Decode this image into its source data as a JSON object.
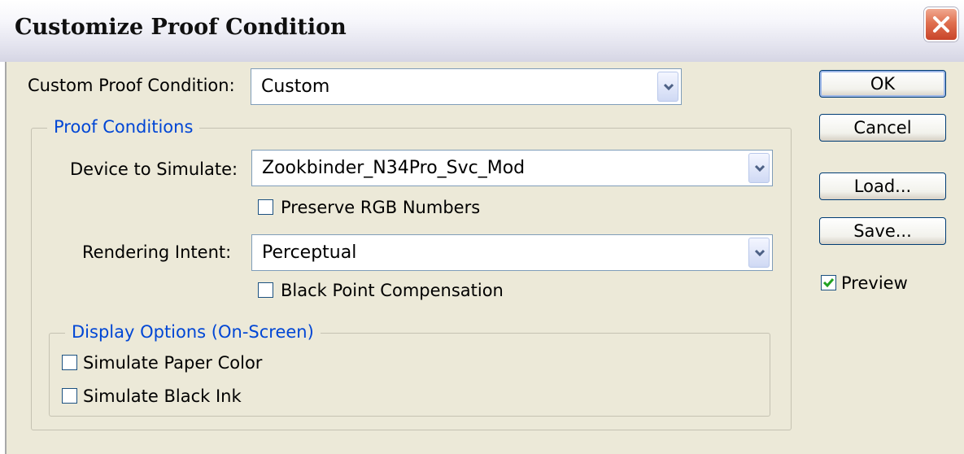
{
  "dialog": {
    "title": "Customize Proof Condition"
  },
  "custom_proof": {
    "label": "Custom Proof Condition:",
    "value": "Custom"
  },
  "proof_conditions": {
    "legend": "Proof Conditions",
    "device_label": "Device to Simulate:",
    "device_value": "Zookbinder_N34Pro_Svc_Mod",
    "preserve_rgb": {
      "label": "Preserve RGB Numbers",
      "checked": false
    },
    "intent_label": "Rendering Intent:",
    "intent_value": "Perceptual",
    "black_point": {
      "label": "Black Point Compensation",
      "checked": false
    }
  },
  "display_options": {
    "legend": "Display Options (On-Screen)",
    "paper_color": {
      "label": "Simulate Paper Color",
      "checked": false
    },
    "black_ink": {
      "label": "Simulate Black Ink",
      "checked": false
    }
  },
  "buttons": {
    "ok": "OK",
    "cancel": "Cancel",
    "load": "Load...",
    "save": "Save..."
  },
  "preview": {
    "label": "Preview",
    "checked": true
  },
  "colors": {
    "legend_blue": "#0046d5",
    "close_red": "#e07050",
    "check_green": "#21a121"
  }
}
